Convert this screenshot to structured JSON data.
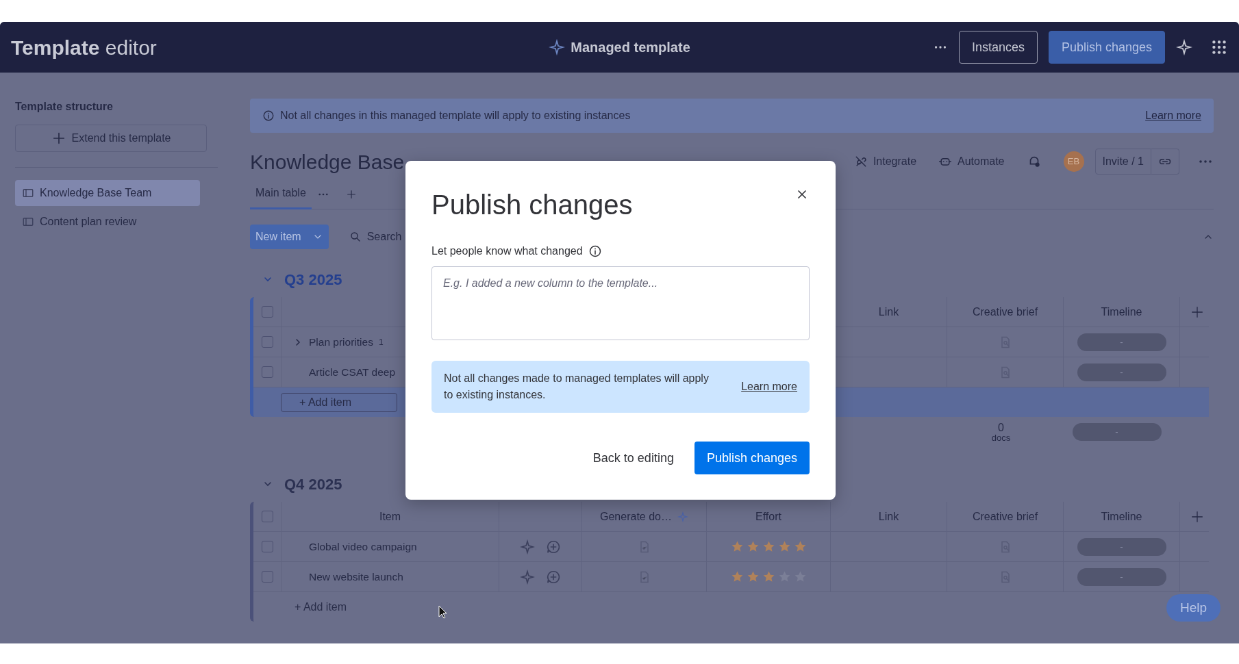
{
  "top_bar": {
    "title_bold": "Template",
    "title_rest": "editor",
    "center_label": "Managed template",
    "buttons": [
      {
        "label": "Instances",
        "kind": "outline"
      },
      {
        "label": "Publish changes",
        "kind": "primary"
      }
    ]
  },
  "sidebar": {
    "heading": "Template structure",
    "extend_button": "Extend this template",
    "items": [
      {
        "label": "Knowledge Base Team",
        "selected": true
      },
      {
        "label": "Content plan review",
        "selected": false
      }
    ]
  },
  "banner": {
    "text": "Not all changes in this managed template will apply to existing instances",
    "link": "Learn more"
  },
  "board": {
    "title": "Knowledge Base",
    "actions": [
      "Integrate",
      "Automate"
    ],
    "avatar": "EB",
    "invite": "Invite / 1",
    "tabs": [
      {
        "label": "Main table",
        "selected": true
      }
    ],
    "new_item": "New item",
    "search": "Search"
  },
  "groups": [
    {
      "title": "Q3 2025",
      "color": "#3f5ca6",
      "all_checked": false,
      "columns": {
        "link": "Link",
        "brief": "Creative brief",
        "timeline": "Timeline"
      },
      "rows": [
        {
          "item": "Plan priorities",
          "subitems": "1",
          "checked": false,
          "timeline": "-"
        },
        {
          "item": "Article CSAT deep",
          "checked": false,
          "timeline": "-"
        }
      ],
      "add_item": {
        "label": "+ Add item",
        "selected": true
      },
      "summary": {
        "docs_count": "0",
        "docs_label": "docs",
        "timeline": "-"
      }
    },
    {
      "title": "Q4 2025",
      "color": "#4b5179",
      "all_checked": false,
      "columns": {
        "item": "Item",
        "generate": "Generate do…",
        "effort": "Effort",
        "link": "Link",
        "brief": "Creative brief",
        "timeline": "Timeline"
      },
      "rows": [
        {
          "item": "Global video campaign",
          "checked": false,
          "stars": 5,
          "timeline": "-"
        },
        {
          "item": "New website launch",
          "checked": false,
          "stars": 3,
          "timeline": "-"
        }
      ],
      "add_item": {
        "label": "+ Add item",
        "selected": false
      }
    }
  ],
  "dialog": {
    "title": "Publish changes",
    "label": "Let people know what changed",
    "placeholder": "E.g. I added a new column to the template...",
    "notice": "Not all changes made to managed templates will apply to existing instances.",
    "notice_link": "Learn more",
    "buttons": [
      {
        "label": "Back to editing",
        "kind": "link"
      },
      {
        "label": "Publish changes",
        "kind": "primary"
      }
    ]
  },
  "help": "Help"
}
